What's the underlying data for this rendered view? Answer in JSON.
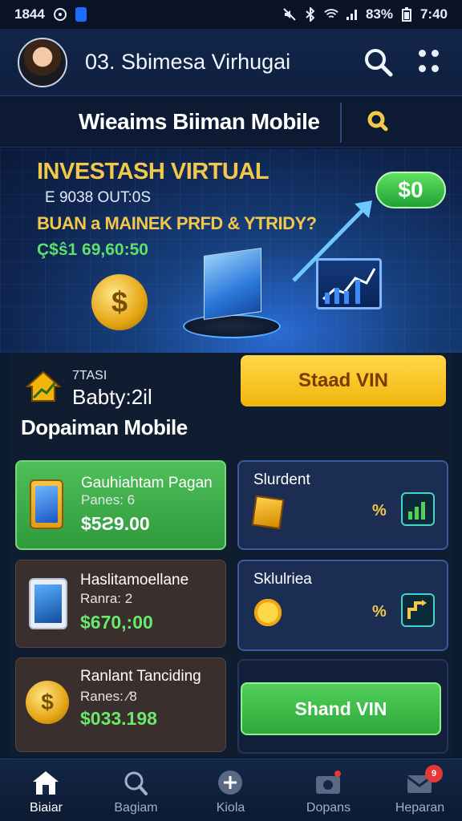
{
  "status_bar": {
    "time": "1844",
    "battery": "83%",
    "clock_right": "7:40",
    "icons": [
      "settings-icon",
      "notification-icon",
      "mute-icon",
      "bluetooth-icon",
      "wifi-icon",
      "signal-icon",
      "battery-icon"
    ]
  },
  "app_bar": {
    "title": "03. Sbimesa Virhugai",
    "actions": [
      "search-icon",
      "grid-menu-icon"
    ]
  },
  "subheader": {
    "title": "Wieaims Biiman Mobile",
    "action_icon": "search-icon"
  },
  "hero": {
    "heading": "INVESTASH VIRTUAL",
    "line2": "E 9038 OUT:0S",
    "line3": "BUAN a MAINEK PRFD & YTRIDY?",
    "amount": "Ç$ŝ1 69,60:50",
    "pill": "$0"
  },
  "invest": {
    "small": "7TASI",
    "value": "Babty:2il",
    "title": "Dopaiman Mobile",
    "primary_button": "Staad VIN"
  },
  "cards": {
    "c1": {
      "title": "Gauhiahtam Pagan",
      "sub": "Panes: 6",
      "amount": "$5Ƨ9.00"
    },
    "c2": {
      "title": "Slurdent",
      "pct": "%"
    },
    "c3": {
      "title": "Haslitamoellane",
      "sub": "Ranra: 2",
      "amount": "$670,:00"
    },
    "c4": {
      "title": "Sklulriea",
      "pct": "%"
    },
    "c5": {
      "title": "Ranlant Tanciding",
      "sub": "Ranes: ⁄8",
      "amount": "$033.198"
    },
    "c6": {
      "button": "Shand VIN"
    }
  },
  "tab_bar": {
    "tabs": [
      {
        "label": "Biaiar",
        "icon": "home-icon"
      },
      {
        "label": "Bagiam",
        "icon": "search-icon"
      },
      {
        "label": "Kiola",
        "icon": "plus-icon"
      },
      {
        "label": "Dopans",
        "icon": "camera-icon"
      },
      {
        "label": "Heparan",
        "icon": "mail-icon"
      }
    ],
    "badge": "9"
  },
  "colors": {
    "background": "#0b1a33",
    "accent_yellow": "#f3c84a",
    "accent_green": "#4fbf59",
    "badge_red": "#e53935"
  }
}
